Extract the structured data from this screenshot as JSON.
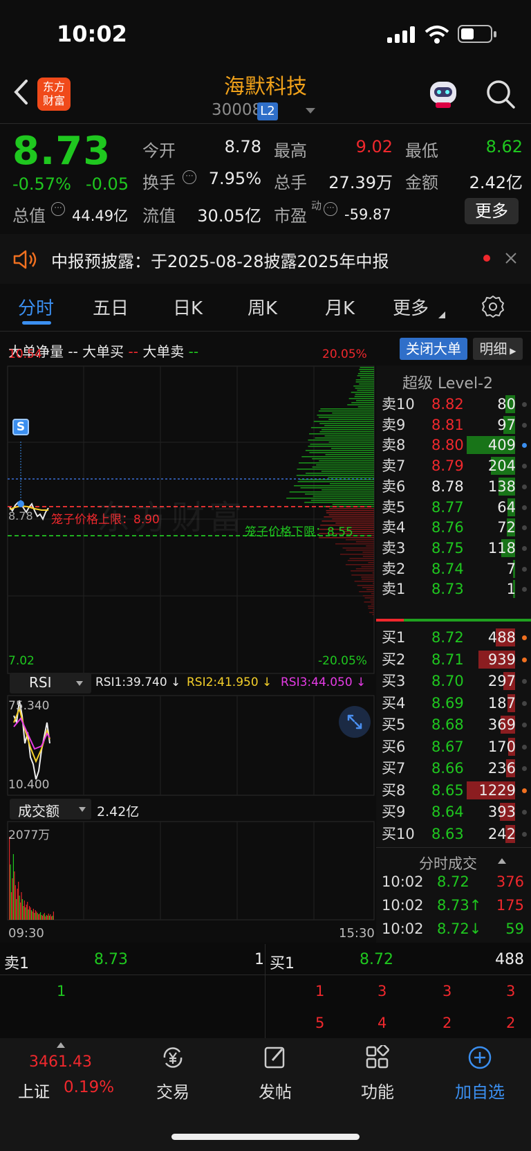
{
  "status_bar": {
    "time": "10:02"
  },
  "header": {
    "brand_line1": "东方",
    "brand_line2": "财富",
    "title": "海默科技",
    "code": "300084",
    "level_badge": "L2"
  },
  "quote": {
    "price": "8.73",
    "change_pct": "-0.57%",
    "change": "-0.05",
    "fields": [
      {
        "label": "今开",
        "value": "8.78",
        "color": "white"
      },
      {
        "label": "最高",
        "value": "9.02",
        "color": "red"
      },
      {
        "label": "最低",
        "value": "8.62",
        "color": "green"
      },
      {
        "label": "换手",
        "value": "7.95%",
        "color": "white"
      },
      {
        "label": "总手",
        "value": "27.39万",
        "color": "white"
      },
      {
        "label": "金额",
        "value": "2.42亿",
        "color": "white"
      },
      {
        "label": "总值",
        "value": "44.49亿",
        "color": "white"
      },
      {
        "label": "流值",
        "value": "30.05亿",
        "color": "white"
      },
      {
        "label": "市盈",
        "value": "-59.87",
        "color": "white"
      }
    ],
    "pe_superscript": "动",
    "more_label": "更多"
  },
  "notice": {
    "text": "中报预披露：于2025-08-28披露2025年中报"
  },
  "tabs": [
    "分时",
    "五日",
    "日K",
    "周K",
    "月K",
    "更多"
  ],
  "legend": {
    "net": "大单净量",
    "buy": "大单买",
    "sell": "大单卖",
    "dash": "--",
    "close_btn": "关闭大单",
    "detail_btn": "明细"
  },
  "chart": {
    "y_top": "10.54",
    "y_bottom": "7.02",
    "pct_top": "20.05%",
    "pct_bottom": "-20.05%",
    "mid_label": "8.78",
    "upper_limit_label": "笼子价格上限：8.90",
    "lower_limit_label": "笼子价格下限：8.55",
    "watermark": "东方财富",
    "marker": "S"
  },
  "rsi": {
    "name": "RSI",
    "rsi1": "RSI1:39.740 ↓",
    "rsi2": "RSI2:41.950 ↓",
    "rsi3": "RSI3:44.050 ↓",
    "top": "75.340",
    "bottom": "10.400"
  },
  "amount": {
    "name": "成交额",
    "value": "2.42亿",
    "top": "2077万",
    "time_start": "09:30",
    "time_end": "15:30"
  },
  "level2": {
    "title": "超级 Level-2",
    "asks": [
      {
        "label": "卖10",
        "price": "8.82",
        "vol": "80",
        "pc": "red"
      },
      {
        "label": "卖9",
        "price": "8.81",
        "vol": "97",
        "pc": "red"
      },
      {
        "label": "卖8",
        "price": "8.80",
        "vol": "409",
        "pc": "red"
      },
      {
        "label": "卖7",
        "price": "8.79",
        "vol": "204",
        "pc": "red"
      },
      {
        "label": "卖6",
        "price": "8.78",
        "vol": "138",
        "pc": "white"
      },
      {
        "label": "卖5",
        "price": "8.77",
        "vol": "64",
        "pc": "green"
      },
      {
        "label": "卖4",
        "price": "8.76",
        "vol": "72",
        "pc": "green"
      },
      {
        "label": "卖3",
        "price": "8.75",
        "vol": "118",
        "pc": "green"
      },
      {
        "label": "卖2",
        "price": "8.74",
        "vol": "7",
        "pc": "green"
      },
      {
        "label": "卖1",
        "price": "8.73",
        "vol": "1",
        "pc": "green"
      }
    ],
    "bids": [
      {
        "label": "买1",
        "price": "8.72",
        "vol": "488",
        "pc": "green"
      },
      {
        "label": "买2",
        "price": "8.71",
        "vol": "939",
        "pc": "green"
      },
      {
        "label": "买3",
        "price": "8.70",
        "vol": "297",
        "pc": "green"
      },
      {
        "label": "买4",
        "price": "8.69",
        "vol": "187",
        "pc": "green"
      },
      {
        "label": "买5",
        "price": "8.68",
        "vol": "369",
        "pc": "green"
      },
      {
        "label": "买6",
        "price": "8.67",
        "vol": "170",
        "pc": "green"
      },
      {
        "label": "买7",
        "price": "8.66",
        "vol": "236",
        "pc": "green"
      },
      {
        "label": "买8",
        "price": "8.65",
        "vol": "1229",
        "pc": "green"
      },
      {
        "label": "买9",
        "price": "8.64",
        "vol": "393",
        "pc": "green"
      },
      {
        "label": "买10",
        "price": "8.63",
        "vol": "242",
        "pc": "green"
      }
    ],
    "ticks_title": "分时成交",
    "ticks": [
      {
        "time": "10:02",
        "price": "8.72",
        "vol": "376",
        "pc": "green",
        "vc": "red"
      },
      {
        "time": "10:02",
        "price": "8.73↑",
        "vol": "175",
        "pc": "green",
        "vc": "red"
      },
      {
        "time": "10:02",
        "price": "8.72↓",
        "vol": "59",
        "pc": "green",
        "vc": "green"
      }
    ]
  },
  "queue": {
    "sell_label": "卖1",
    "sell_price": "8.73",
    "sell_count": "1",
    "buy_label": "买1",
    "buy_price": "8.72",
    "buy_count": "488",
    "sell_items": [
      "1"
    ],
    "buy_items_row1": [
      "1",
      "3",
      "3",
      "3"
    ],
    "buy_items_row2": [
      "5",
      "4",
      "2",
      "2"
    ]
  },
  "bottom_nav": {
    "index_value": "3461.43",
    "index_name": "上证",
    "index_pct": "0.19%",
    "items": [
      "交易",
      "发帖",
      "功能",
      "加自选"
    ]
  }
}
